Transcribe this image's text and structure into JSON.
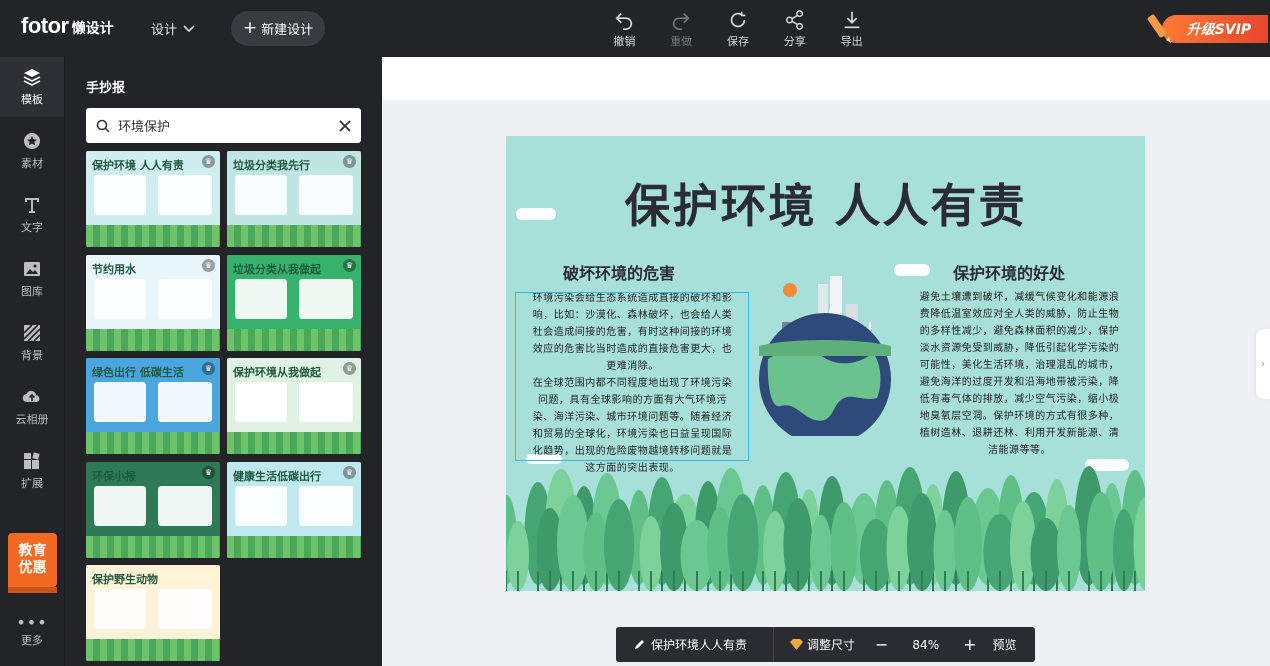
{
  "header": {
    "brand": "fotor",
    "brand_sub": "懒设计",
    "design_menu": "设计",
    "new_design": "新建设计",
    "tools": [
      {
        "label": "撤销",
        "icon": "undo-icon"
      },
      {
        "label": "重做",
        "icon": "redo-icon"
      },
      {
        "label": "保存",
        "icon": "save-icon"
      },
      {
        "label": "分享",
        "icon": "share-icon"
      },
      {
        "label": "导出",
        "icon": "export-icon"
      }
    ],
    "vip": "升级SVIP"
  },
  "nav": {
    "items": [
      {
        "label": "模板",
        "icon": "template-icon"
      },
      {
        "label": "素材",
        "icon": "material-icon"
      },
      {
        "label": "文字",
        "icon": "text-icon"
      },
      {
        "label": "图库",
        "icon": "gallery-icon"
      },
      {
        "label": "背景",
        "icon": "background-icon"
      },
      {
        "label": "云相册",
        "icon": "cloud-upload-icon"
      },
      {
        "label": "扩展",
        "icon": "extension-icon"
      }
    ],
    "edu_line1": "教育",
    "edu_line2": "优惠",
    "more": "更多"
  },
  "panel": {
    "title": "手抄报",
    "search_value": "环境保护",
    "thumbs": [
      {
        "title": "保护环境  人人有责",
        "bg": "#cfeef0"
      },
      {
        "title": "垃圾分类我先行",
        "bg": "#bfe6e3"
      },
      {
        "title": "节约用水",
        "bg": "#e8f6fb"
      },
      {
        "title": "垃圾分类从我做起",
        "bg": "#37b26c"
      },
      {
        "title": "绿色出行 低碳生活",
        "bg": "#4aa6dc"
      },
      {
        "title": "保护环境从我做起",
        "bg": "#dff2e4"
      },
      {
        "title": "环保小报",
        "bg": "#2f7a56"
      },
      {
        "title": "健康生活低碳出行",
        "bg": "#bfe9ef"
      },
      {
        "title": "保护野生动物",
        "bg": "#fff2d6"
      }
    ]
  },
  "poster": {
    "title": "保护环境  人人有责",
    "left_heading": "破坏环境的危害",
    "left_p1": "环境污染会给生态系统造成直接的破坏和影响，比如：沙漠化、森林破坏，也会给人类社会造成间接的危害，有时这种间接的环境效应的危害比当时造成的直接危害更大，也更难消除。",
    "left_p2": "在全球范围内都不同程度地出现了环境污染问题，具有全球影响的方面有大气环境污染、海洋污染、城市环境问题等。随着经济和贸易的全球化，环境污染也日益呈现国际化趋势，出现的危险废物越境转移问题就是这方面的突出表现。",
    "right_heading": "保护环境的好处",
    "right_p": "避免土壤遭到破坏，减缓气候变化和能源浪费降低温室效应对全人类的威胁，防止生物的多样性减少，避免森林面积的减少，保护淡水资源免受到威胁，降低引起化学污染的可能性，美化生活环境，治理混乱的城市，避免海洋的过度开发和沿海地带被污染，降低有毒气体的排放，减少空气污染，缩小极地臭氧层空洞。保护环境的方式有很多种，植树造林、退耕还林、利用开发新能源、清洁能源等等。",
    "bg_color": "#a7e0d9"
  },
  "bottombar": {
    "name": "保护环境人人有责",
    "resize": "调整尺寸",
    "zoom": "84%",
    "preview": "预览"
  }
}
